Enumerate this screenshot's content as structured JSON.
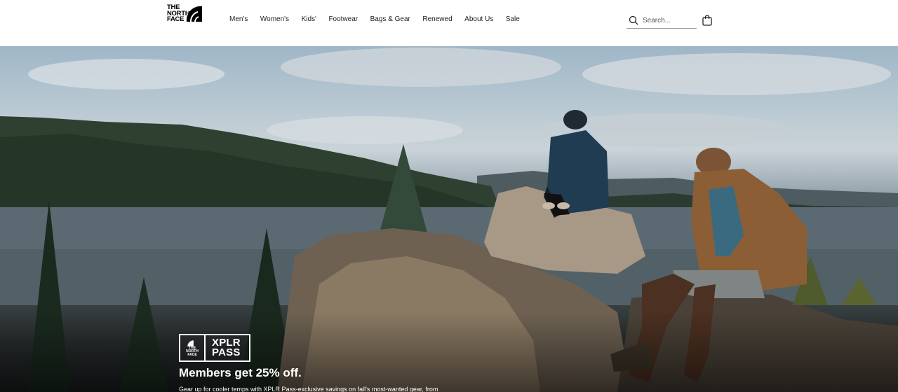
{
  "header": {
    "logo_lines": [
      "THE",
      "NORTH",
      "FACE"
    ],
    "nav": [
      "Men's",
      "Women's",
      "Kids'",
      "Footwear",
      "Bags & Gear",
      "Renewed",
      "About Us",
      "Sale"
    ],
    "search": {
      "placeholder": "Search..."
    },
    "icons": {
      "search": "search-icon",
      "bag": "shopping-bag-icon"
    }
  },
  "hero": {
    "badge": {
      "logo_lines": [
        "THE",
        "NORTH",
        "FACE"
      ],
      "pass_lines": [
        "XPLR",
        "PASS"
      ]
    },
    "title": "Members get 25% off.",
    "subtitle": "Gear up for cooler temps with XPLR Pass-exclusive savings on fall's most-wanted gear, from"
  },
  "colors": {
    "header_bg": "#ffffff",
    "text": "#000000",
    "promo_text": "#ffffff"
  }
}
